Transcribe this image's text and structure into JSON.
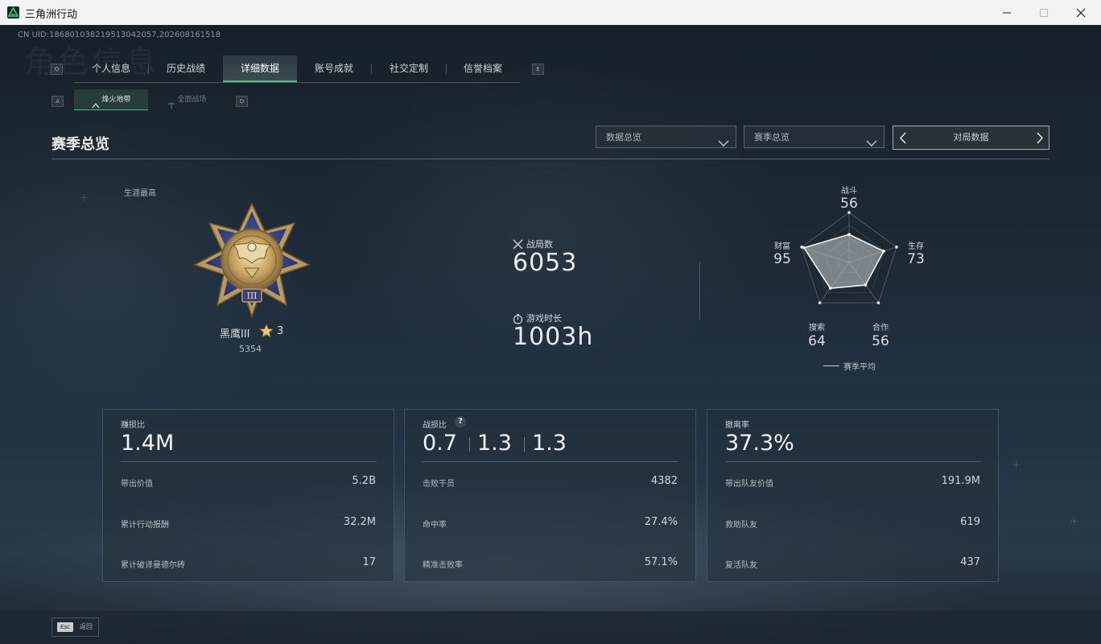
{
  "window": {
    "title": "三角洲行动"
  },
  "header": {
    "uid": "CN UID:18680103821951304205​7,202608161518",
    "watermark": "角色信息",
    "key_left": "Q",
    "key_right": "E",
    "subkey_left": "A",
    "subkey_right": "D"
  },
  "tabs": [
    {
      "label": "个人信息"
    },
    {
      "label": "历史战绩"
    },
    {
      "label": "详细数据"
    },
    {
      "label": "账号成就"
    },
    {
      "label": "社交定制"
    },
    {
      "label": "信誉档案"
    }
  ],
  "subtabs": [
    {
      "label": "烽火地带"
    },
    {
      "label": "全面战场"
    }
  ],
  "section": {
    "title": "赛季总览"
  },
  "filters": {
    "dropdown1": "数据总览",
    "dropdown2": "赛季总览",
    "pager_label": "对局数据"
  },
  "career": {
    "label": "生涯最高",
    "rank_name": "黑鹰III",
    "stars": "3",
    "points": "5354",
    "medal_numeral": "III"
  },
  "stats": {
    "matches_label": "战局数",
    "matches_value": "6053",
    "playtime_label": "游戏时长",
    "playtime_value": "1003h"
  },
  "radar": {
    "axes": [
      {
        "label": "战斗",
        "value": "56",
        "score": 56
      },
      {
        "label": "生存",
        "value": "73",
        "score": 73
      },
      {
        "label": "合作",
        "value": "56",
        "score": 56
      },
      {
        "label": "搜索",
        "value": "64",
        "score": 64
      },
      {
        "label": "财富",
        "value": "95",
        "score": 95
      }
    ],
    "legend": "赛季平均"
  },
  "cards": [
    {
      "title": "赚损比",
      "big": "1.4M",
      "rows": [
        {
          "label": "带出价值",
          "value": "5.2B"
        },
        {
          "label": "累计行动报酬",
          "value": "32.2M"
        },
        {
          "label": "累计破译曼德尔砖",
          "value": "17"
        }
      ]
    },
    {
      "title": "战损比",
      "help": "?",
      "kd": [
        "0.7",
        "1.3",
        "1.3"
      ],
      "rows": [
        {
          "label": "击败干员",
          "value": "4382"
        },
        {
          "label": "命中率",
          "value": "27.4%"
        },
        {
          "label": "精准击败率",
          "value": "57.1%"
        }
      ]
    },
    {
      "title": "撤离率",
      "big": "37.3%",
      "rows": [
        {
          "label": "带出队友价值",
          "value": "191.9M"
        },
        {
          "label": "救助队友",
          "value": "619"
        },
        {
          "label": "复活队友",
          "value": "437"
        }
      ]
    }
  ],
  "footer": {
    "esc_key": "Esc",
    "back_label": "返回"
  },
  "icons": {
    "app": "delta-logo-icon",
    "matches": "crossed-swords-icon",
    "playtime": "stopwatch-icon",
    "star": "star-icon"
  },
  "colors": {
    "accent": "#41c48a",
    "background": "#1d2a35",
    "text": "#e8ecef"
  }
}
